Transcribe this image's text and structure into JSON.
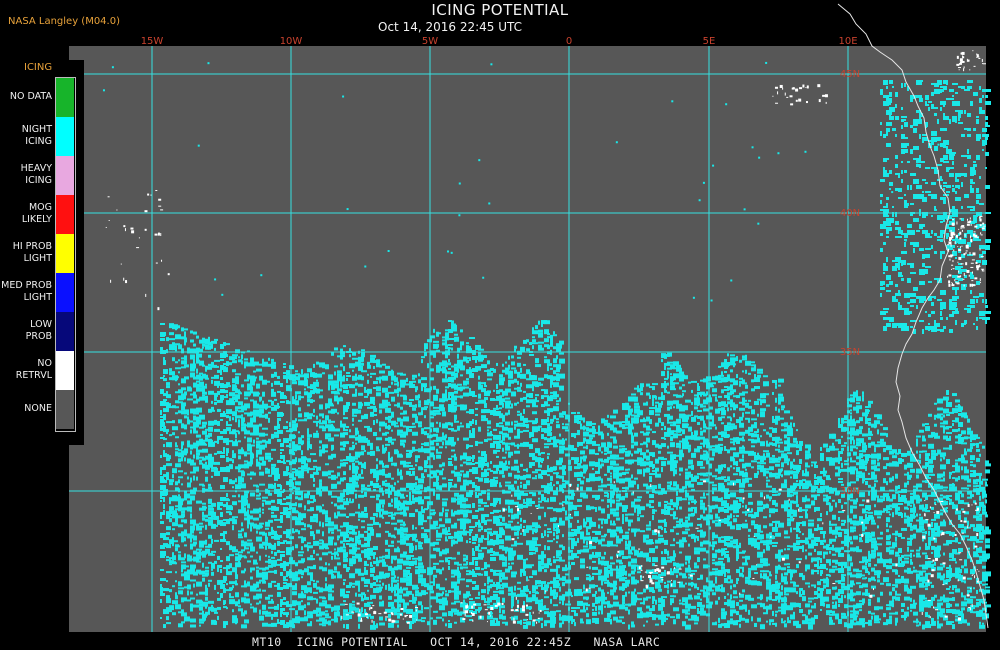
{
  "header": {
    "org": "NASA Langley (M04.0)",
    "title": "ICING POTENTIAL",
    "subtitle": "Oct 14, 2016 22:45 UTC"
  },
  "map": {
    "background_color": "#575757",
    "grid_color": "#35e0e0",
    "icing_color": "#19e8e8",
    "coastline_color": "#e6e6e6",
    "lon_labels": [
      "15W",
      "10W",
      "5W",
      "0",
      "5E",
      "10E"
    ],
    "lat_labels": [
      "45N",
      "40N",
      "35N",
      "30N"
    ]
  },
  "legend": {
    "title": "ICING",
    "items": [
      {
        "label": [
          "NO DATA"
        ],
        "color": "#17b42a"
      },
      {
        "label": [
          "NIGHT",
          "ICING"
        ],
        "color": "#00ffff"
      },
      {
        "label": [
          "HEAVY",
          "ICING"
        ],
        "color": "#e8a8e0"
      },
      {
        "label": [
          "MOG",
          "LIKELY"
        ],
        "color": "#ff1010"
      },
      {
        "label": [
          "HI PROB",
          "LIGHT"
        ],
        "color": "#ffff00"
      },
      {
        "label": [
          "MED PROB",
          "LIGHT"
        ],
        "color": "#0a10ff"
      },
      {
        "label": [
          "LOW",
          "PROB"
        ],
        "color": "#06087a"
      },
      {
        "label": [
          "NO",
          "RETRVL"
        ],
        "color": "#ffffff"
      },
      {
        "label": [
          "NONE"
        ],
        "color": "#575757"
      }
    ]
  },
  "footer": {
    "text": "MT10  ICING POTENTIAL   OCT 14, 2016 22:45Z   NASA LARC"
  }
}
